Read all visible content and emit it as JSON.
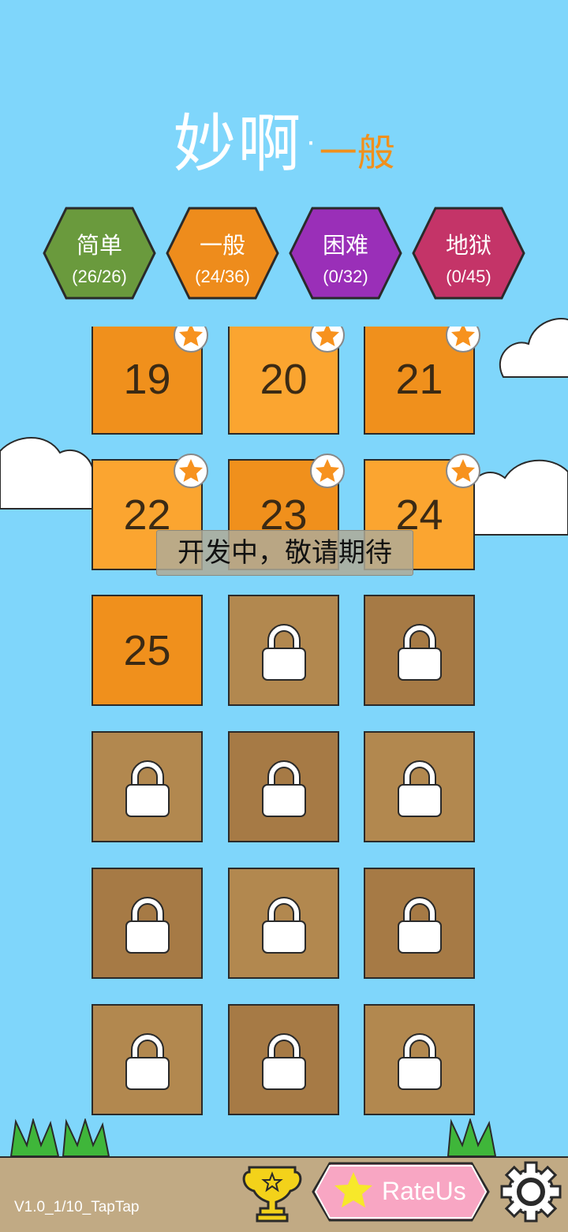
{
  "title": {
    "main": "妙啊",
    "dot": "·",
    "sub": "一般"
  },
  "difficulties": [
    {
      "name": "简单",
      "progress": "(26/26)",
      "color": "#6a9a3d"
    },
    {
      "name": "一般",
      "progress": "(24/36)",
      "color": "#ee8c1c"
    },
    {
      "name": "困难",
      "progress": "(0/32)",
      "color": "#9a2fb8"
    },
    {
      "name": "地狱",
      "progress": "(0/45)",
      "color": "#c43468"
    }
  ],
  "levels": [
    {
      "num": "19",
      "state": "starred"
    },
    {
      "num": "20",
      "state": "starred"
    },
    {
      "num": "21",
      "state": "starred"
    },
    {
      "num": "22",
      "state": "starred"
    },
    {
      "num": "23",
      "state": "starred"
    },
    {
      "num": "24",
      "state": "starred"
    },
    {
      "num": "25",
      "state": "open"
    },
    {
      "num": "",
      "state": "locked"
    },
    {
      "num": "",
      "state": "locked"
    },
    {
      "num": "",
      "state": "locked"
    },
    {
      "num": "",
      "state": "locked"
    },
    {
      "num": "",
      "state": "locked"
    },
    {
      "num": "",
      "state": "locked"
    },
    {
      "num": "",
      "state": "locked"
    },
    {
      "num": "",
      "state": "locked"
    },
    {
      "num": "",
      "state": "locked"
    },
    {
      "num": "",
      "state": "locked"
    },
    {
      "num": "",
      "state": "locked"
    }
  ],
  "toast": "开发中，敬请期待",
  "bottom": {
    "version": "V1.0_1/10_TapTap",
    "rate_label": "RateUs",
    "trophy_icon": "trophy-icon",
    "settings_icon": "gear-icon"
  },
  "colors": {
    "sky": "#7fd6fb",
    "tile_open": "#f0901c",
    "tile_open_alt": "#fba530",
    "tile_locked": "#a67a45",
    "rate_button": "#f8a6c3",
    "star": "#f7921e"
  }
}
